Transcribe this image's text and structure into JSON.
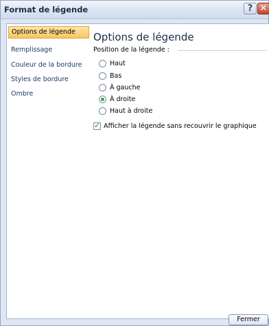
{
  "window": {
    "title": "Format de légende"
  },
  "titlebar": {
    "help_glyph": "?",
    "close_glyph": "✕"
  },
  "nav": {
    "items": [
      {
        "label": "Options de légende"
      },
      {
        "label": "Remplissage"
      },
      {
        "label": "Couleur de la bordure"
      },
      {
        "label": "Styles de bordure"
      },
      {
        "label": "Ombre"
      }
    ]
  },
  "content": {
    "title": "Options de légende",
    "position_label": "Position de la légende :",
    "options": [
      {
        "label": "Haut",
        "checked": false
      },
      {
        "label": "Bas",
        "checked": false
      },
      {
        "label": "À gauche",
        "checked": false
      },
      {
        "label": "À droite",
        "checked": true
      },
      {
        "label": "Haut à droite",
        "checked": false
      }
    ],
    "overlay_checkbox": {
      "label": "Afficher la légende sans recouvrir le graphique",
      "checked": true
    }
  },
  "footer": {
    "close_label": "Fermer"
  },
  "colors": {
    "selected_tab": "#f8c562",
    "radio_checked": "#3aa23a",
    "close_red": "#c5402a"
  }
}
